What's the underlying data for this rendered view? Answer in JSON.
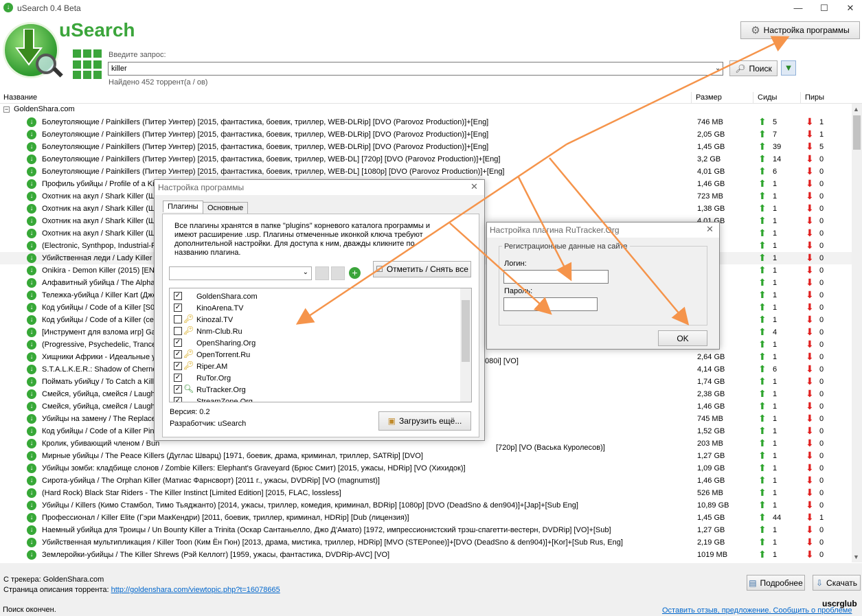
{
  "window": {
    "title": "uSearch 0.4 Beta",
    "min": "—",
    "max": "☐",
    "close": "✕"
  },
  "brand": "uSearch",
  "settings_button": "Настройка программы",
  "query": {
    "label": "Введите запрос:",
    "value": "killer",
    "found": "Найдено 452 торрент(а / ов)"
  },
  "search_button": "Поиск",
  "columns": {
    "name": "Название",
    "size": "Размер",
    "seeds": "Сиды",
    "peers": "Пиры"
  },
  "group": "GoldenShara.com",
  "rows": [
    {
      "name": "Болеутоляющие / Painkillers (Питер Уинтер) [2015, фантастика, боевик, триллер, WEB-DLRip] [DVO (Parovoz Production)]+[Eng]",
      "size": "746 MB",
      "seeds": "5",
      "peers": "1"
    },
    {
      "name": "Болеутоляющие / Painkillers (Питер Уинтер) [2015, фантастика, боевик, триллер, WEB-DLRip] [DVO (Parovoz Production)]+[Eng]",
      "size": "2,05 GB",
      "seeds": "7",
      "peers": "1"
    },
    {
      "name": "Болеутоляющие / Painkillers (Питер Уинтер) [2015, фантастика, боевик, триллер, WEB-DLRip] [DVO (Parovoz Production)]+[Eng]",
      "size": "1,45 GB",
      "seeds": "39",
      "peers": "5"
    },
    {
      "name": "Болеутоляющие / Painkillers (Питер Уинтер) [2015, фантастика, боевик, триллер, WEB-DL] [720p] [DVO (Parovoz Production)]+[Eng]",
      "size": "3,2 GB",
      "seeds": "14",
      "peers": "0"
    },
    {
      "name": "Болеутоляющие / Painkillers (Питер Уинтер) [2015, фантастика, боевик, триллер, WEB-DL] [1080p] [DVO (Parovoz Production)]+[Eng]",
      "size": "4,01 GB",
      "seeds": "6",
      "peers": "0"
    },
    {
      "name": "Профиль убийцы / Profile of a Kill",
      "size": "1,46 GB",
      "seeds": "1",
      "peers": "0"
    },
    {
      "name": "Охотник на акул / Shark Killer (Ш",
      "size": "723 MB",
      "seeds": "1",
      "peers": "0"
    },
    {
      "name": "Охотник на акул / Shark Killer (Ш",
      "size": "1,38 GB",
      "seeds": "1",
      "peers": "0"
    },
    {
      "name": "Охотник на акул / Shark Killer (Ш",
      "size": "4,01 GB",
      "seeds": "1",
      "peers": "0"
    },
    {
      "name": "Охотник на акул / Shark Killer (Ш",
      "size": "",
      "seeds": "1",
      "peers": "0"
    },
    {
      "name": "(Electronic, Synthpop, Industrial-Ro",
      "size": "",
      "seeds": "1",
      "peers": "0"
    },
    {
      "name": "Убийственная леди / Lady Killer (",
      "size": "",
      "seeds": "1",
      "peers": "0"
    },
    {
      "name": "Onikira - Demon Killer (2015) [ENG]",
      "size": "",
      "seeds": "1",
      "peers": "0"
    },
    {
      "name": "Алфавитный убийца / The Alphab",
      "size": "",
      "seeds": "1",
      "peers": "0"
    },
    {
      "name": "Тележка-убийца / Killer Kart (Дже",
      "size": "",
      "seeds": "1",
      "peers": "0"
    },
    {
      "name": "Код убийцы / Code of a Killer [S01",
      "size": "",
      "seeds": "1",
      "peers": "0"
    },
    {
      "name": "Код убийцы / Code of a Killer (сез",
      "size": "",
      "seeds": "1",
      "peers": "0"
    },
    {
      "name": "[Инструмент для взлома игр] Ga",
      "size": "",
      "seeds": "4",
      "peers": "0"
    },
    {
      "name": "(Progressive, Psychedelic, Trance)",
      "size": "",
      "seeds": "1",
      "peers": "0"
    },
    {
      "name": "Хищники Африки - Идеальные у",
      "size": "2,64 GB",
      "seeds": "1",
      "peers": "0"
    },
    {
      "name": "S.T.A.L.K.E.R.: Shadow of Chernol",
      "size": "4,14 GB",
      "seeds": "6",
      "peers": "0"
    },
    {
      "name": "Поймать убийцу / To Catch a Kille",
      "size": "1,74 GB",
      "seeds": "1",
      "peers": "0"
    },
    {
      "name": "Смейся, убийца, смейся / Laugh",
      "size": "2,38 GB",
      "seeds": "1",
      "peers": "0"
    },
    {
      "name": "Смейся, убийца, смейся / Laugh",
      "size": "1,46 GB",
      "seeds": "1",
      "peers": "0"
    },
    {
      "name": "Убийцы на замену / The Replace",
      "size": "745 MB",
      "seeds": "1",
      "peers": "0"
    },
    {
      "name": "Код убийцы / Code of a Killer Pine",
      "size": "1,52 GB",
      "seeds": "1",
      "peers": "0"
    },
    {
      "name": "Кролик, убивающий членом / Bun",
      "size": "203 MB",
      "seeds": "1",
      "peers": "0"
    },
    {
      "name": "Мирные убийцы / The Peace Killers (Дуглас Шварц) [1971, боевик, драма, криминал, триллер, SATRip] [DVO]",
      "size": "1,27 GB",
      "seeds": "1",
      "peers": "0"
    },
    {
      "name": "Убийцы зомби: кладбище слонов / Zombie Killers: Elephant's Graveyard (Брюс Смит) [2015, ужасы, HDRip] [VO (Хихидок)]",
      "size": "1,09 GB",
      "seeds": "1",
      "peers": "0"
    },
    {
      "name": "Сирота-убийца / The Orphan Killer (Матиас Фарнсворт) [2011 г., ужасы, DVDRip] [VO (magnumst)]",
      "size": "1,46 GB",
      "seeds": "1",
      "peers": "0"
    },
    {
      "name": "(Hard Rock) Black Star Riders - The Killer Instinct [Limited Edition] [2015, FLAC, lossless]",
      "size": "526 MB",
      "seeds": "1",
      "peers": "0"
    },
    {
      "name": "Убийцы / Killers (Кимо Стамбол, Тимо Тьяджанто) [2014, ужасы, триллер, комедия, криминал, BDRip] [1080p] [DVO (DeadSno & den904)]+[Jap]+[Sub Eng]",
      "size": "10,89 GB",
      "seeds": "1",
      "peers": "0"
    },
    {
      "name": "Профессионал / Killer Elite (Гэри МакКендри) [2011, боевик, триллер, криминал, HDRip] [Dub (лицензия)]",
      "size": "1,45 GB",
      "seeds": "44",
      "peers": "1"
    },
    {
      "name": "Наемный убийца для Троицы / Un Bounty Killer a Trinita (Оскар Сантаньелло, Джо Д'Амато) [1972, импрессионистский трэш-спагетти-вестерн, DVDRip] [VO]+[Sub]",
      "size": "1,27 GB",
      "seeds": "1",
      "peers": "0"
    },
    {
      "name": "Убийственная мультипликация / Killer Toon (Ким Ён Гюн) [2013, драма, мистика, триллер, HDRip] [MVO (STEPonee)]+[DVO (DeadSno & den904)]+[Kor]+[Sub Rus, Eng]",
      "size": "2,19 GB",
      "seeds": "1",
      "peers": "0"
    },
    {
      "name": "Землеройки-убийцы / The Killer Shrews (Рэй Келлогг) [1959, ужасы, фантастика, DVDRip-AVC] [VO]",
      "size": "1019 MB",
      "seeds": "1",
      "peers": "0"
    }
  ],
  "row_tail": {
    "r19": "080i] [VO]",
    "r26": "[720p] [VO (Васька Куролесов)]"
  },
  "bottom": {
    "tracker": "С трекера: GoldenShara.com",
    "desc_label": "Страница описания торрента:",
    "desc_url": "http://goldenshara.com/viewtopic.php?t=16078665",
    "more": "Подробнее",
    "download": "Скачать",
    "status": "Поиск окончен.",
    "feedback": "Оставить отзыв, предложение. Сообщить о проблеме",
    "watermark": "uscrglub"
  },
  "settings_dialog": {
    "title": "Настройка программы",
    "close": "✕",
    "tabs": [
      "Плагины",
      "Основные"
    ],
    "info": "Все плагины хранятся в папке \"plugins\" корневого каталога программы и имеют расширение .usp. Плагины отмеченные иконкой ключа требуют дополнительной настройки. Для доступа к ним, дважды кликните по названию плагина.",
    "toggle_all": "Отметить / Снять все",
    "plugins": [
      {
        "name": "GoldenShara.com",
        "checked": true,
        "icon": "none"
      },
      {
        "name": "KinoArena.TV",
        "checked": true,
        "icon": "none"
      },
      {
        "name": "Kinozal.TV",
        "checked": false,
        "icon": "key-icon"
      },
      {
        "name": "Nnm-Club.Ru",
        "checked": false,
        "icon": "key-icon"
      },
      {
        "name": "OpenSharing.Org",
        "checked": true,
        "icon": "none"
      },
      {
        "name": "OpenTorrent.Ru",
        "checked": true,
        "icon": "key-icon"
      },
      {
        "name": "Riper.AM",
        "checked": true,
        "icon": "key-icon"
      },
      {
        "name": "RuTor.Org",
        "checked": true,
        "icon": "none"
      },
      {
        "name": "RuTracker.Org",
        "checked": true,
        "icon": "search-key-icon"
      },
      {
        "name": "StreamZone.Org",
        "checked": true,
        "icon": "none"
      }
    ],
    "version": "Версия: 0.2",
    "developer": "Разработчик: uSearch",
    "load_more": "Загрузить ещё..."
  },
  "plugin_dialog": {
    "title": "Настройка плагина RuTracker.Org",
    "close": "✕",
    "group": "Регистрационные данные на сайте",
    "login_label": "Логин:",
    "password_label": "Пароль:",
    "ok": "OK"
  },
  "colors": {
    "accent": "#3ba53b",
    "arrow": "#f5944b",
    "link": "#0066cc"
  }
}
